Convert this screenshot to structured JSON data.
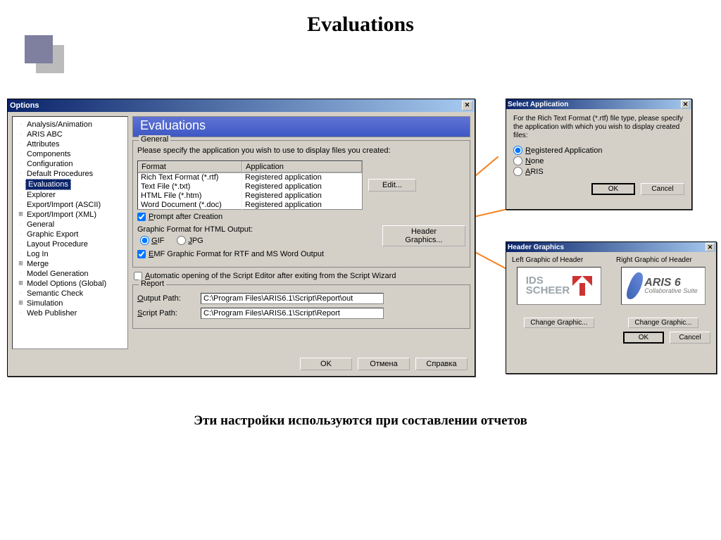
{
  "page_title": "Evaluations",
  "caption": "Эти настройки используются при составлении отчетов",
  "options_window": {
    "title": "Options",
    "tree": [
      {
        "label": "Analysis/Animation",
        "expandable": false
      },
      {
        "label": "ARIS ABC",
        "expandable": false
      },
      {
        "label": "Attributes",
        "expandable": false
      },
      {
        "label": "Components",
        "expandable": false
      },
      {
        "label": "Configuration",
        "expandable": false
      },
      {
        "label": "Default Procedures",
        "expandable": false
      },
      {
        "label": "Evaluations",
        "expandable": false,
        "selected": true
      },
      {
        "label": "Explorer",
        "expandable": false
      },
      {
        "label": "Export/Import (ASCII)",
        "expandable": false
      },
      {
        "label": "Export/Import (XML)",
        "expandable": true
      },
      {
        "label": "General",
        "expandable": false
      },
      {
        "label": "Graphic Export",
        "expandable": false
      },
      {
        "label": "Layout Procedure",
        "expandable": false
      },
      {
        "label": "Log In",
        "expandable": false
      },
      {
        "label": "Merge",
        "expandable": true
      },
      {
        "label": "Model Generation",
        "expandable": false
      },
      {
        "label": "Model Options (Global)",
        "expandable": true
      },
      {
        "label": "Semantic Check",
        "expandable": false
      },
      {
        "label": "Simulation",
        "expandable": true
      },
      {
        "label": "Web Publisher",
        "expandable": false
      }
    ],
    "panel": {
      "header": "Evaluations",
      "general": {
        "legend": "General",
        "instruction": "Please specify the application you wish to use to display files you created:",
        "columns": {
          "format": "Format",
          "application": "Application"
        },
        "rows": [
          {
            "format": "Rich Text Format (*.rtf)",
            "application": "Registered application"
          },
          {
            "format": "Text File (*.txt)",
            "application": "Registered application"
          },
          {
            "format": "HTML File (*.htm)",
            "application": "Registered application"
          },
          {
            "format": "Word Document (*.doc)",
            "application": "Registered application"
          }
        ],
        "edit_button": "Edit...",
        "prompt_after_creation": {
          "label": "Prompt after Creation",
          "checked": true
        },
        "graphic_format_label": "Graphic Format for HTML Output:",
        "gif_label": "GIF",
        "jpg_label": "JPG",
        "gif_selected": true,
        "header_graphics_button": "Header Graphics...",
        "emf_label": "EMF Graphic Format for RTF and MS Word Output",
        "emf_checked": true
      },
      "auto_open": {
        "label": "Automatic opening of the Script Editor after exiting from the Script Wizard",
        "checked": false
      },
      "report": {
        "legend": "Report",
        "output_path_label": "Output Path:",
        "output_path_value": "C:\\Program Files\\ARIS6.1\\Script\\Report\\out",
        "script_path_label": "Script Path:",
        "script_path_value": "C:\\Program Files\\ARIS6.1\\Script\\Report"
      }
    },
    "buttons": {
      "ok": "OK",
      "cancel": "Отмена",
      "help": "Справка"
    }
  },
  "select_app": {
    "title": "Select Application",
    "text": "For the Rich Text Format (*.rtf) file type, please specify the application with which you wish to display created files:",
    "options": {
      "registered": "Registered Application",
      "none": "None",
      "aris": "ARIS"
    },
    "ok": "OK",
    "cancel": "Cancel"
  },
  "header_graphics": {
    "title": "Header Graphics",
    "left_label": "Left Graphic of Header",
    "right_label": "Right Graphic of Header",
    "ids_text": "IDS\nSCHEER",
    "aris_text": "ARIS 6",
    "aris_sub": "Collaborative Suite",
    "change_button": "Change Graphic...",
    "ok": "OK",
    "cancel": "Cancel"
  }
}
